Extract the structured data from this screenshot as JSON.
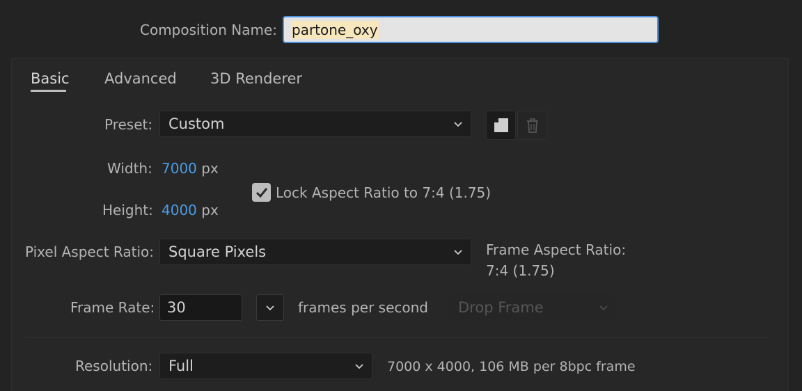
{
  "composition_name": {
    "label": "Composition Name:",
    "value": "partone_oxy"
  },
  "tabs": [
    {
      "label": "Basic",
      "active": true
    },
    {
      "label": "Advanced",
      "active": false
    },
    {
      "label": "3D Renderer",
      "active": false
    }
  ],
  "preset": {
    "label": "Preset:",
    "value": "Custom"
  },
  "width": {
    "label": "Width:",
    "value": "7000",
    "unit": "px"
  },
  "height": {
    "label": "Height:",
    "value": "4000",
    "unit": "px"
  },
  "lock_aspect": {
    "label": "Lock Aspect Ratio to 7:4 (1.75)",
    "checked": true
  },
  "pixel_aspect": {
    "label": "Pixel Aspect Ratio:",
    "value": "Square Pixels"
  },
  "frame_aspect": {
    "label": "Frame Aspect Ratio:",
    "value": "7:4 (1.75)"
  },
  "frame_rate": {
    "label": "Frame Rate:",
    "value": "30",
    "unit_label": "frames per second",
    "drop_frame": "Drop Frame"
  },
  "resolution": {
    "label": "Resolution:",
    "value": "Full",
    "info": "7000 x 4000, 106 MB per 8bpc frame"
  },
  "icons": [
    "new-preset-icon",
    "delete-preset-icon",
    "chevron-down-icon",
    "checkmark-icon"
  ],
  "colors": {
    "accent": "#4a9ce6",
    "focus_border": "#4a8fe0",
    "background": "#232323"
  }
}
